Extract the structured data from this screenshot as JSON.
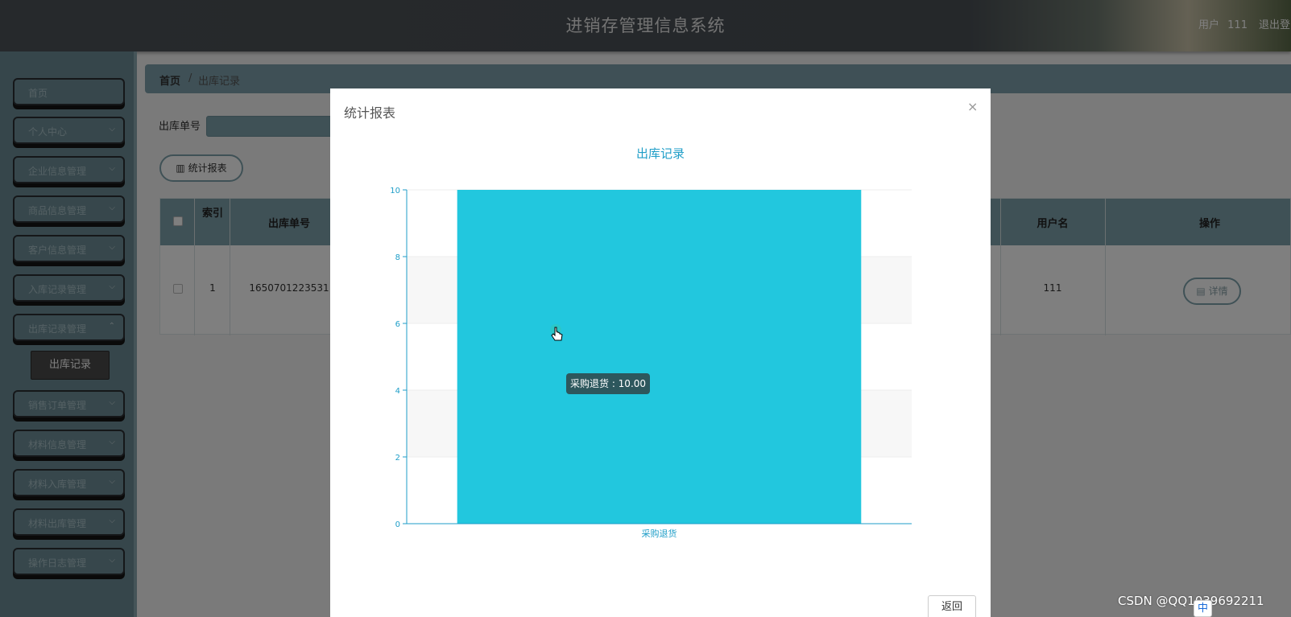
{
  "header": {
    "title": "进销存管理信息系统",
    "user_label": "用户",
    "user_name": "111",
    "logout": "退出登"
  },
  "sidebar": {
    "items": [
      {
        "label": "首页"
      },
      {
        "label": "个人中心"
      },
      {
        "label": "企业信息管理"
      },
      {
        "label": "商品信息管理"
      },
      {
        "label": "客户信息管理"
      },
      {
        "label": "入库记录管理"
      },
      {
        "label": "出库记录管理"
      },
      {
        "label": "销售订单管理"
      },
      {
        "label": "材料信息管理"
      },
      {
        "label": "材料入库管理"
      },
      {
        "label": "材料出库管理"
      },
      {
        "label": "操作日志管理"
      }
    ],
    "active_sub": "出库记录"
  },
  "breadcrumb": {
    "home": "首页",
    "separator": "/",
    "current": "出库记录"
  },
  "search": {
    "label": "出库单号"
  },
  "toolbar": {
    "stats_label": "统计报表"
  },
  "table": {
    "headers": {
      "index": "索引",
      "order_no": "出库单号",
      "username": "用户名",
      "actions": "操作"
    },
    "rows": [
      {
        "index": "1",
        "order_no": "1650701223531",
        "username": "111",
        "action": "详情"
      }
    ]
  },
  "modal": {
    "title": "统计报表",
    "close": "×",
    "back_label": "返回"
  },
  "chart_data": {
    "type": "bar",
    "title": "出库记录",
    "categories": [
      "采购退货"
    ],
    "values": [
      10
    ],
    "ylim": [
      0,
      10
    ],
    "yticks": [
      "0",
      "2",
      "4",
      "6",
      "8",
      "10"
    ],
    "color": "#22c7de",
    "axis_color": "#1f9ec8",
    "grid": true
  },
  "tooltip": {
    "text": "采购退货 : 10.00"
  },
  "watermark": "CSDN @QQ1039692211",
  "ime": "中"
}
